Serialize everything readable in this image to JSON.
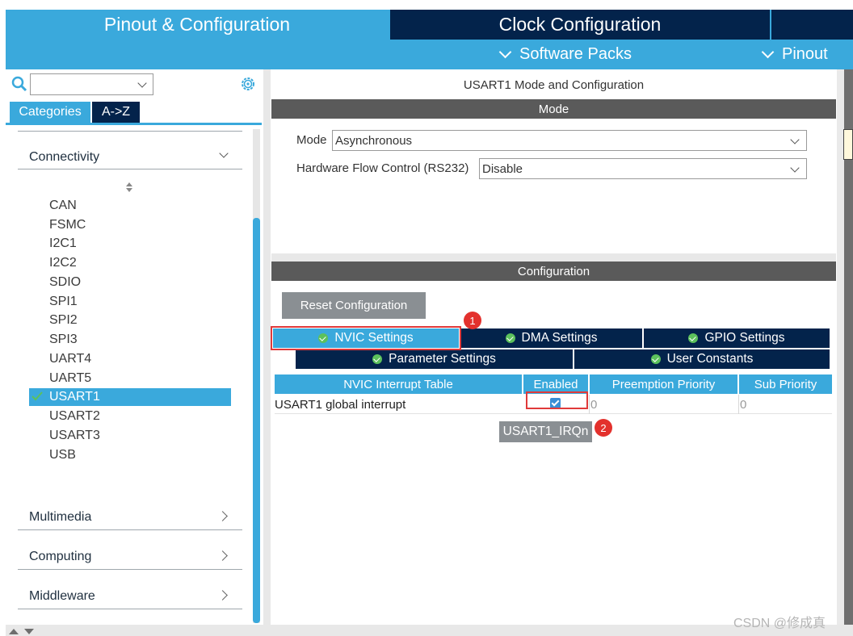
{
  "header": {
    "tab_pinout": "Pinout & Configuration",
    "tab_clock": "Clock Configuration",
    "menu_software_packs": "Software Packs",
    "menu_pinout": "Pinout"
  },
  "sidebar": {
    "search": {
      "value": "",
      "placeholder": ""
    },
    "tabs": [
      {
        "label": "Categories"
      },
      {
        "label": "A->Z"
      }
    ],
    "categories": {
      "connectivity": "Connectivity",
      "multimedia": "Multimedia",
      "computing": "Computing",
      "middleware": "Middleware"
    },
    "peripherals": [
      "CAN",
      "FSMC",
      "I2C1",
      "I2C2",
      "SDIO",
      "SPI1",
      "SPI2",
      "SPI3",
      "UART4",
      "UART5",
      "USART1",
      "USART2",
      "USART3",
      "USB"
    ],
    "selected": "USART1"
  },
  "main": {
    "title": "USART1 Mode and Configuration",
    "mode_section": "Mode",
    "mode_label": "Mode",
    "mode_value": "Asynchronous",
    "hw_flow_label": "Hardware Flow Control (RS232)",
    "hw_flow_value": "Disable",
    "config_section": "Configuration",
    "reset_button": "Reset Configuration",
    "tabs": {
      "nvic": "NVIC Settings",
      "dma": "DMA Settings",
      "gpio": "GPIO Settings",
      "parameter": "Parameter Settings",
      "user_constants": "User Constants"
    },
    "table": {
      "headers": [
        "NVIC Interrupt Table",
        "Enabled",
        "Preemption Priority",
        "Sub Priority"
      ],
      "rows": [
        {
          "name": "USART1 global interrupt",
          "enabled": true,
          "preemption": "0",
          "sub": "0"
        }
      ]
    },
    "irq_label": "USART1_IRQn",
    "annotations": [
      "1",
      "2"
    ]
  },
  "watermark": "CSDN @修成真",
  "colors": {
    "accent_blue": "#3aa9dc",
    "dark_navy": "#03234b",
    "section_gray": "#5a5a5a",
    "annotation_red": "#e3312d",
    "check_green": "#5cc15c"
  }
}
